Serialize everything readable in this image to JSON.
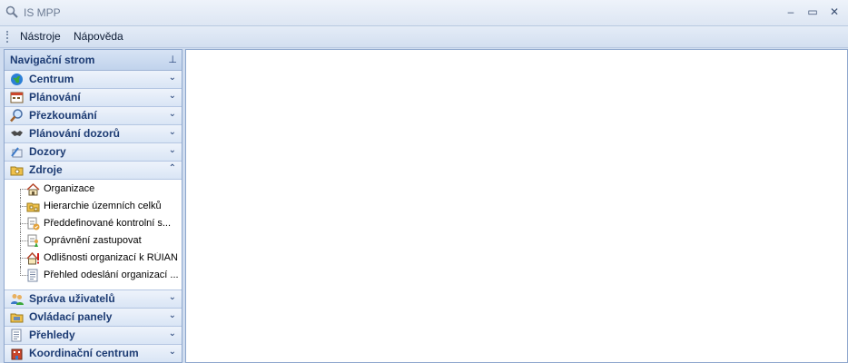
{
  "window": {
    "title": "IS MPP",
    "minimize": "–",
    "maximize": "▭",
    "close": "✕"
  },
  "menu": {
    "items": [
      {
        "label": "Nástroje"
      },
      {
        "label": "Nápověda"
      }
    ]
  },
  "sidebar": {
    "header": "Navigační strom",
    "pin_glyph": "⊥",
    "groups_top": [
      {
        "label": "Centrum",
        "icon": "globe-icon",
        "chevron": "⌄"
      },
      {
        "label": "Plánování",
        "icon": "calendar-icon",
        "chevron": "⌄"
      },
      {
        "label": "Přezkoumání",
        "icon": "magnifier-icon",
        "chevron": "⌄"
      },
      {
        "label": "Plánování dozorů",
        "icon": "handshake-icon",
        "chevron": "⌄"
      },
      {
        "label": "Dozory",
        "icon": "pen-icon",
        "chevron": "⌄"
      },
      {
        "label": "Zdroje",
        "icon": "folder-icon",
        "chevron": "⌃"
      }
    ],
    "zdroje_items": [
      {
        "label": "Organizace",
        "icon": "house-icon"
      },
      {
        "label": "Hierarchie územních celků",
        "icon": "folder-tree-icon"
      },
      {
        "label": "Předdefinované kontrolní s...",
        "icon": "checklist-icon"
      },
      {
        "label": "Oprávnění zastupovat",
        "icon": "authorization-icon"
      },
      {
        "label": "Odlišnosti organizací k RÚIAN",
        "icon": "house-warning-icon"
      },
      {
        "label": "Přehled odeslání organizací ...",
        "icon": "document-icon"
      }
    ],
    "groups_bottom": [
      {
        "label": "Správa uživatelů",
        "icon": "users-icon",
        "chevron": "⌄"
      },
      {
        "label": "Ovládací panely",
        "icon": "control-panel-icon",
        "chevron": "⌄"
      },
      {
        "label": "Přehledy",
        "icon": "report-icon",
        "chevron": "⌄"
      },
      {
        "label": "Koordinační centrum",
        "icon": "building-icon",
        "chevron": "⌄"
      }
    ]
  },
  "colors": {
    "accent": "#1c3b73",
    "frame": "#8ea7cd",
    "background": "#cfdcef"
  }
}
